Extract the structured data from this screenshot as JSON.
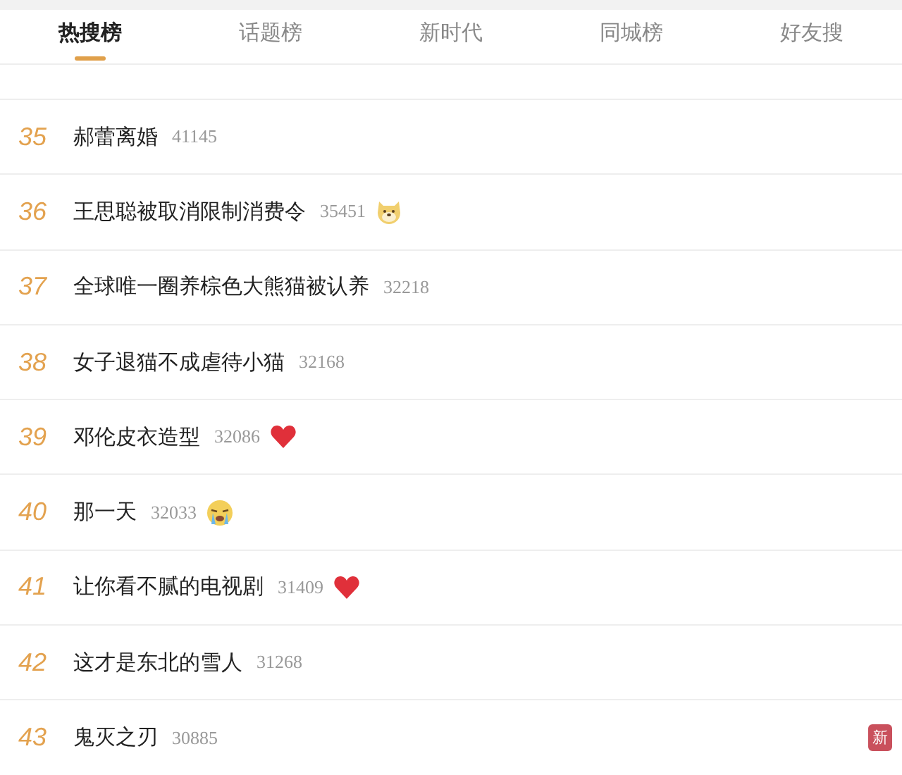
{
  "tabs": [
    {
      "label": "热搜榜",
      "selected": true
    },
    {
      "label": "话题榜",
      "selected": false
    },
    {
      "label": "新时代",
      "selected": false
    },
    {
      "label": "同城榜",
      "selected": false
    },
    {
      "label": "好友搜",
      "selected": false
    }
  ],
  "rows": [
    {
      "rank": "35",
      "title": "郝蕾离婚",
      "count": "41145"
    },
    {
      "rank": "36",
      "title": "王思聪被取消限制消费令",
      "count": "35451",
      "badge": {
        "kind": "dog"
      }
    },
    {
      "rank": "37",
      "title": "全球唯一圈养棕色大熊猫被认养",
      "count": "32218"
    },
    {
      "rank": "38",
      "title": "女子退猫不成虐待小猫",
      "count": "32168"
    },
    {
      "rank": "39",
      "title": "邓伦皮衣造型",
      "count": "32086",
      "badge": {
        "kind": "heart"
      }
    },
    {
      "rank": "40",
      "title": "那一天",
      "count": "32033",
      "badge": {
        "kind": "cry"
      }
    },
    {
      "rank": "41",
      "title": "让你看不腻的电视剧",
      "count": "31409",
      "badge": {
        "kind": "heart"
      }
    },
    {
      "rank": "42",
      "title": "这才是东北的雪人",
      "count": "31268"
    },
    {
      "rank": "43",
      "title": "鬼灭之刃",
      "count": "30885",
      "tag": "新"
    }
  ]
}
